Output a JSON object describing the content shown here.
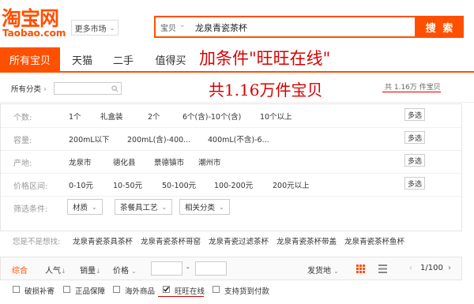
{
  "header": {
    "logo_cn": "淘宝网",
    "logo_en": "Taobao.com",
    "market_label": "更多市场",
    "search_category": "宝贝",
    "search_value": "龙泉青瓷茶杯",
    "search_button": "搜 索"
  },
  "tabs": [
    "所有宝贝",
    "天猫",
    "二手",
    "值得买"
  ],
  "annotations": {
    "top": "加条件\"旺旺在线\"",
    "middle": "共1.16万件宝贝"
  },
  "category_row": {
    "label": "所有分类",
    "count_text": "共 1.16万 件宝贝"
  },
  "filters": [
    {
      "label": "个数:",
      "options": [
        "1个",
        "礼盒装",
        "2个",
        "6个(含)-10个(含)",
        "10个以上"
      ],
      "multi": "多选"
    },
    {
      "label": "容量:",
      "options": [
        "200mL以下",
        "200mL(含)-400...",
        "400mL(不含)-6..."
      ],
      "multi": "多选"
    },
    {
      "label": "产地:",
      "options": [
        "龙泉市",
        "德化县",
        "景德镇市",
        "潮州市"
      ],
      "multi": "多选"
    },
    {
      "label": "价格区间:",
      "options": [
        "0-10元",
        "10-50元",
        "50-100元",
        "100-200元",
        "200元以上"
      ],
      "multi": "多选"
    }
  ],
  "conditions": {
    "label": "筛选条件:",
    "dropdowns": [
      "材质",
      "茶餐具工艺",
      "相关分类"
    ]
  },
  "suggestions": {
    "label": "您是不是想找:",
    "items": [
      "龙泉青瓷茶具茶杯",
      "龙泉青瓷茶杯哥窑",
      "龙泉青瓷过滤茶杯",
      "龙泉青瓷茶杯带盖",
      "龙泉青瓷茶杯鱼杯"
    ]
  },
  "sort": {
    "items": [
      "综合",
      "人气",
      "销量",
      "价格"
    ],
    "price_sep": "-",
    "ship_from": "发货地",
    "page": "1/100"
  },
  "checkboxes": [
    {
      "label": "破损补寄",
      "checked": false
    },
    {
      "label": "正品保障",
      "checked": false
    },
    {
      "label": "海外商品",
      "checked": false
    },
    {
      "label": "旺旺在线",
      "checked": true
    },
    {
      "label": "支持货到付款",
      "checked": false
    }
  ],
  "colors": {
    "brand": "#ff5000",
    "annotation": "#d60000"
  }
}
